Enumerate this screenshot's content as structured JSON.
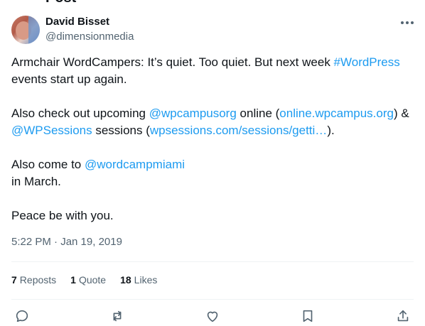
{
  "header": {
    "title_partial": "Post"
  },
  "author": {
    "name": "David Bisset",
    "handle": "@dimensionmedia"
  },
  "tweet": {
    "line1_text": "Armchair WordCampers: It’s quiet. Too quiet. But next week ",
    "line1_hashtag": "#WordPress",
    "line1_tail": " events start up again.",
    "p2_a": "Also check out upcoming ",
    "p2_mention1": "@wpcampusorg",
    "p2_b": " online (",
    "p2_url1": "online.wpcampus.org",
    "p2_c": ") & ",
    "p2_mention2": "@WPSessions",
    "p2_d": " sessions (",
    "p2_url2": "wpsessions.com/sessions/getti…",
    "p2_e": ").",
    "p3_a": "Also come to ",
    "p3_mention": "@wordcampmiami",
    "p3_b": "in March.",
    "p4": "Peace be with you."
  },
  "timestamp": "5:22 PM · Jan 19, 2019",
  "stats": {
    "reposts_count": "7",
    "reposts_label": "Reposts",
    "quotes_count": "1",
    "quotes_label": "Quote",
    "likes_count": "18",
    "likes_label": "Likes"
  },
  "actions": [
    "reply-icon",
    "repost-icon",
    "like-icon",
    "bookmark-icon",
    "share-icon"
  ],
  "colors": {
    "link": "#1d9bf0",
    "secondary_text": "#536471",
    "primary_text": "#0f1419",
    "divider": "#eff3f4"
  }
}
